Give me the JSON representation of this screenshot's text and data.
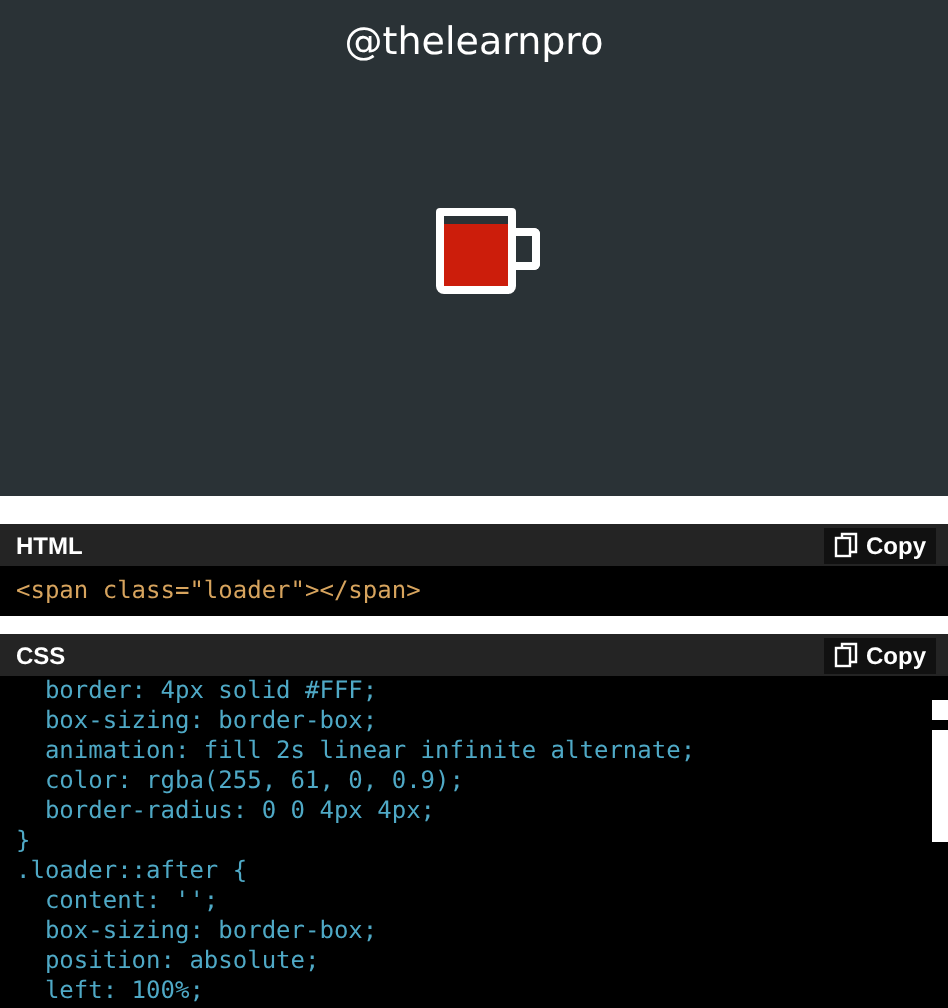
{
  "preview": {
    "handle": "@thelearnpro",
    "loader": {
      "level": 0.9
    }
  },
  "panels": [
    {
      "title": "HTML",
      "copy_label": "Copy",
      "kind": "html",
      "lines": [
        "<span class=\"loader\"></span>"
      ]
    },
    {
      "title": "CSS",
      "copy_label": "Copy",
      "kind": "css",
      "lines": [
        "  border: 4px solid #FFF;",
        "  box-sizing: border-box;",
        "  animation: fill 2s linear infinite alternate;",
        "  color: rgba(255, 61, 0, 0.9);",
        "  border-radius: 0 0 4px 4px;",
        "}",
        ".loader::after {",
        "  content: '';",
        "  box-sizing: border-box;",
        "  position: absolute;",
        "  left: 100%;"
      ]
    }
  ]
}
